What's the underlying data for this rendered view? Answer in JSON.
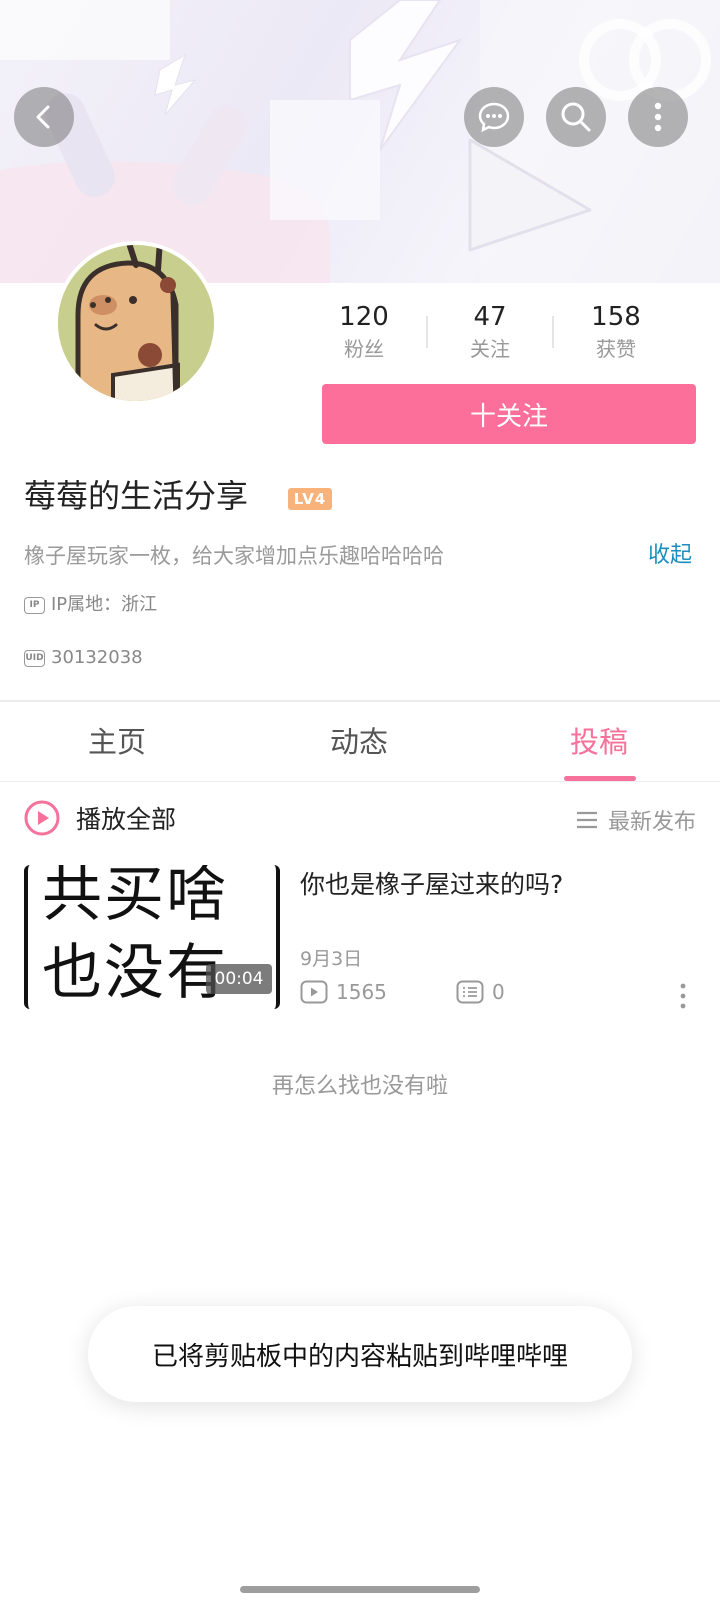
{
  "header": {
    "back_icon": "chevron-left-icon",
    "message_icon": "chat-bubble-icon",
    "search_icon": "search-icon",
    "more_icon": "more-vertical-icon"
  },
  "profile": {
    "stats": [
      {
        "value": "120",
        "label": "粉丝"
      },
      {
        "value": "47",
        "label": "关注"
      },
      {
        "value": "158",
        "label": "获赞"
      }
    ],
    "follow_label": "十关注",
    "name": "莓莓的生活分享",
    "level": "LV4",
    "bio": "橡子屋玩家一枚，给大家增加点乐趣哈哈哈哈",
    "collapse_label": "收起",
    "ip_label": "IP属地：浙江",
    "uid": "30132038",
    "accent_color": "#fb6f9a",
    "link_color": "#1a8fbf"
  },
  "tabs": [
    {
      "label": "主页",
      "active": false
    },
    {
      "label": "动态",
      "active": false
    },
    {
      "label": "投稿",
      "active": true
    }
  ],
  "list": {
    "play_all_label": "播放全部",
    "sort_label": "最新发布",
    "videos": [
      {
        "thumb_text_line1": "共买啥",
        "thumb_text_line2": "也没有",
        "duration": "00:04",
        "title": "你也是橡子屋过来的吗?",
        "date": "9月3日",
        "views": "1565",
        "comments": "0"
      }
    ],
    "end_tip": "再怎么找也没有啦"
  },
  "toast": {
    "message": "已将剪贴板中的内容粘贴到哔哩哔哩"
  }
}
